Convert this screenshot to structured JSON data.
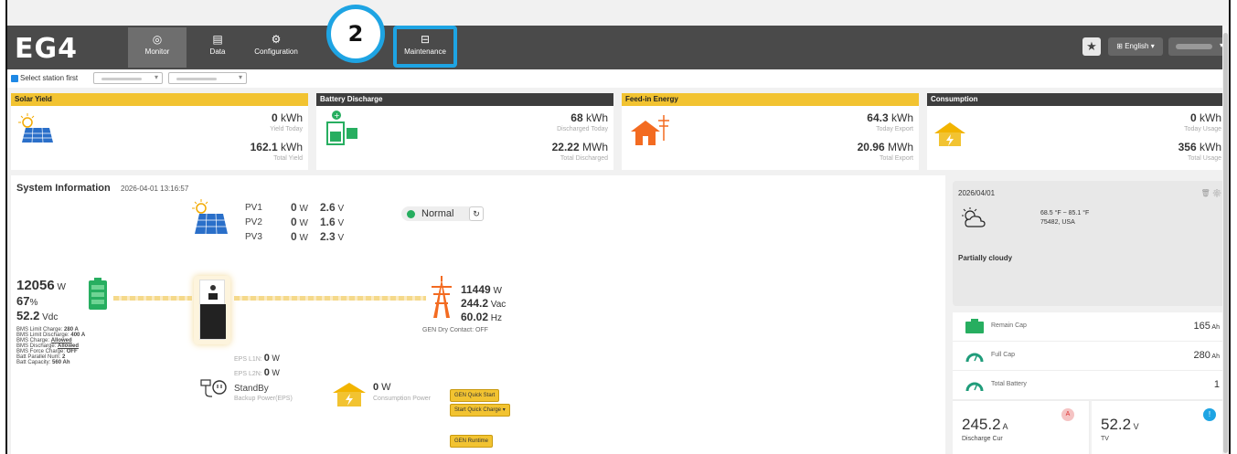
{
  "nav": {
    "logo": "EG4",
    "items": [
      {
        "label": "Monitor",
        "icon": "compass-icon",
        "active": true
      },
      {
        "label": "Data",
        "icon": "database-icon"
      },
      {
        "label": "Configuration",
        "icon": "gear-icon"
      }
    ],
    "maintenance": "Maintenance",
    "step_badge": "2",
    "language": "English",
    "star_icon": "star-icon"
  },
  "station": {
    "select_label": "Select station first"
  },
  "cards": {
    "solar": {
      "title": "Solar Yield",
      "v1": "0",
      "u1": " kWh",
      "l1": "Yield Today",
      "v2": "162.1",
      "u2": " kWh",
      "l2": "Total Yield"
    },
    "battery": {
      "title": "Battery Discharge",
      "v1": "68",
      "u1": " kWh",
      "l1": "Discharged Today",
      "v2": "22.22",
      "u2": " MWh",
      "l2": "Total Discharged"
    },
    "feed": {
      "title": "Feed-in Energy",
      "v1": "64.3",
      "u1": " kWh",
      "l1": "Today Export",
      "v2": "20.96",
      "u2": " MWh",
      "l2": "Total Export"
    },
    "consumption": {
      "title": "Consumption",
      "v1": "0",
      "u1": " kWh",
      "l1": "Today Usage",
      "v2": "356",
      "u2": " kWh",
      "l2": "Total Usage"
    }
  },
  "system": {
    "title": "System Information",
    "timestamp": "2026-04-01 13:16:57",
    "pv": [
      {
        "name": "PV1",
        "w": "0",
        "wu": " W",
        "v": "2.6",
        "vu": " V"
      },
      {
        "name": "PV2",
        "w": "0",
        "wu": " W",
        "v": "1.6",
        "vu": " V"
      },
      {
        "name": "PV3",
        "w": "0",
        "wu": " W",
        "v": "2.3",
        "vu": " V"
      }
    ],
    "status": "Normal",
    "battery": {
      "power": "12056",
      "power_u": " W",
      "soc": "67",
      "soc_u": "%",
      "voltage": "52.2",
      "voltage_u": " Vdc",
      "bms": [
        {
          "label": "BMS Limit Charge: ",
          "value": "280 A"
        },
        {
          "label": "BMS Limit Discharge: ",
          "value": "400 A"
        },
        {
          "label": "BMS Charge: ",
          "value": "Allowed"
        },
        {
          "label": "BMS Discharge: ",
          "value": "Allowed"
        },
        {
          "label": "BMS Force Charge: ",
          "value": "OFF"
        },
        {
          "label": "Batt Parallel Num: ",
          "value": "2"
        },
        {
          "label": "Batt Capacity: ",
          "value": "560 Ah"
        }
      ]
    },
    "grid": {
      "power": "11449",
      "power_u": " W",
      "voltage": "244.2",
      "voltage_u": " Vac",
      "freq": "60.02",
      "freq_u": " Hz",
      "dry_contact": "GEN Dry Contact: OFF"
    },
    "eps": {
      "l1_label": "EPS L1N: ",
      "l1_value": "0",
      "l1_u": " W",
      "l2_label": "EPS L2N: ",
      "l2_value": "0",
      "l2_u": " W",
      "state": "StandBy",
      "desc": "Backup Power(EPS)"
    },
    "consumption": {
      "value": "0",
      "unit": " W",
      "desc": "Consumption Power"
    },
    "buttons": {
      "gen_quick_start": "GEN Quick Start",
      "start_quick_charge": "Start Quick Charge",
      "gen_runtime": "GEN Runtime"
    }
  },
  "weather": {
    "date": "2026/04/01",
    "temp": "68.5 °F ~ 85.1 °F",
    "location": "75482, USA",
    "desc": "Partially cloudy"
  },
  "battery_panel": {
    "rows": [
      {
        "label": "Remain Cap",
        "value": "165",
        "unit": " Ah"
      },
      {
        "label": "Full Cap",
        "value": "280",
        "unit": " Ah"
      },
      {
        "label": "Total Battery",
        "value": "1",
        "unit": ""
      }
    ],
    "discharge": {
      "value": "245.2",
      "unit": " A",
      "label": "Discharge Cur"
    },
    "tv": {
      "value": "52.2",
      "unit": " V",
      "label": "TV"
    }
  },
  "colors": {
    "accent": "#1ea4e3",
    "yellow": "#f2c331",
    "dark": "#3d3d3d",
    "green": "#27ae60"
  }
}
